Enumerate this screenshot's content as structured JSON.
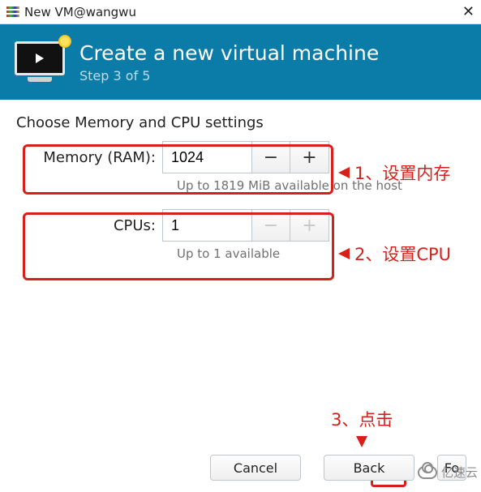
{
  "window": {
    "title": "New VM@wangwu"
  },
  "header": {
    "title": "Create a new virtual machine",
    "step": "Step 3 of 5"
  },
  "prompt": "Choose Memory and CPU settings",
  "memory": {
    "label": "Memory (RAM):",
    "value": "1024",
    "hint": "Up to 1819 MiB available on the host"
  },
  "cpus": {
    "label": "CPUs:",
    "value": "1",
    "hint": "Up to 1 available"
  },
  "annotations": {
    "a1": "1、设置内存",
    "a2": "2、设置CPU",
    "a3": "3、点击"
  },
  "footer": {
    "cancel": "Cancel",
    "back": "Back",
    "forward": "Fo"
  },
  "watermark": "亿速云"
}
